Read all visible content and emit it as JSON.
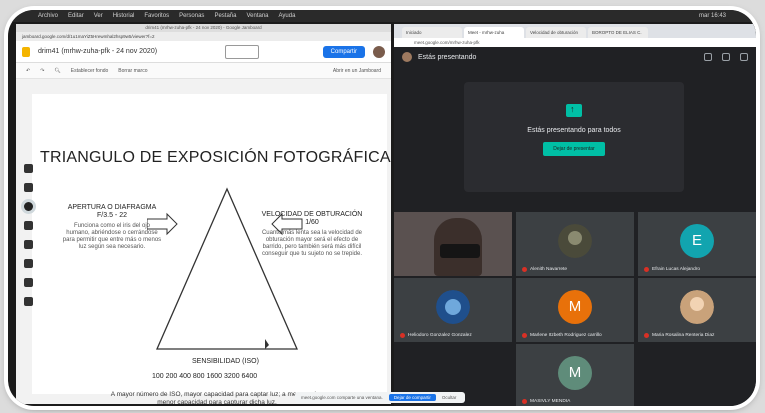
{
  "menubar": {
    "items": [
      "Archivo",
      "Editar",
      "Ver",
      "Historial",
      "Favoritos",
      "Personas",
      "Pestaña",
      "Ventana",
      "Ayuda"
    ],
    "clock": "mar 16:43"
  },
  "jamboard": {
    "window_title": "drim41 (mrhw-zuha-pfk - 24 nov 2020) - Google Jamboard",
    "url": "jamboard.google.com/d/1u1maYiZ5Hrewmhal2hsp9w5/viewer?f=2",
    "doc_title": "drim41 (mrhw-zuha-pfk - 24 nov 2020)",
    "share_label": "Compartir",
    "toolbar": {
      "reset": "Establecer fondo",
      "clear": "Borrar marco",
      "open": "Abrir en un Jamboard"
    },
    "board": {
      "title": "TRIANGULO DE EXPOSICIÓN FOTOGRÁFICA",
      "apertura_title": "APERTURA O DIAFRAGMA",
      "apertura_value": "F/3.5 - 22",
      "apertura_desc": "Funciona como el iris del ojo humano, abriéndose o cerrándose para permitir que entre más o menos luz según sea necesario.",
      "velocidad_title": "VELOCIDAD DE OBTURACIÓN",
      "velocidad_value": "1/60",
      "velocidad_desc": "Cuanto más lenta sea la velocidad de obturación mayor será el efecto de barrido, pero también será más difícil conseguir que tu sujeto no se trepide.",
      "iso_label": "SENSIBILIDAD (ISO)",
      "iso_values": "100  200  400  800  1600  3200  6400",
      "iso_note": "A mayor número de ISO, mayor capacidad para captar luz; a menor valor, menor capacidad para capturar dicha luz."
    }
  },
  "meet": {
    "tabs": [
      "Iniciado",
      "Meet - mrhw-zuha",
      "Velocidad de obturación",
      "BOROPTO DE ELIAS C."
    ],
    "url": "meet.google.com/mrhw-zuha-pfk",
    "presenting_label": "Estás presentando",
    "present_text": "Estás presentando para todos",
    "stop_label": "Dejar de presentar",
    "participants": [
      {
        "name": "",
        "kind": "video"
      },
      {
        "name": "Alenith Navarrete",
        "kind": "photo",
        "color": "#4a4a3a"
      },
      {
        "name": "Efrain Lucas Alejandro",
        "kind": "letter",
        "letter": "E",
        "color": "#12a4af"
      },
      {
        "name": "Heliodoro Gonzalez Gonzalez",
        "kind": "photo",
        "color": "#1f4f8c"
      },
      {
        "name": "Marlene Itzbeth Rodriguez carrillo",
        "kind": "letter",
        "letter": "M",
        "color": "#e8710a"
      },
      {
        "name": "Maria Rosalina Renteria Diaz",
        "kind": "photo",
        "color": "#c9a27a"
      },
      {
        "name": "MASIVLY MENDIA",
        "kind": "letter",
        "letter": "M",
        "color": "#5f8c7a"
      }
    ]
  },
  "share_bar": {
    "text": "meet.google.com comparte una ventana.",
    "stop": "Dejar de compartir",
    "hide": "Ocultar"
  }
}
